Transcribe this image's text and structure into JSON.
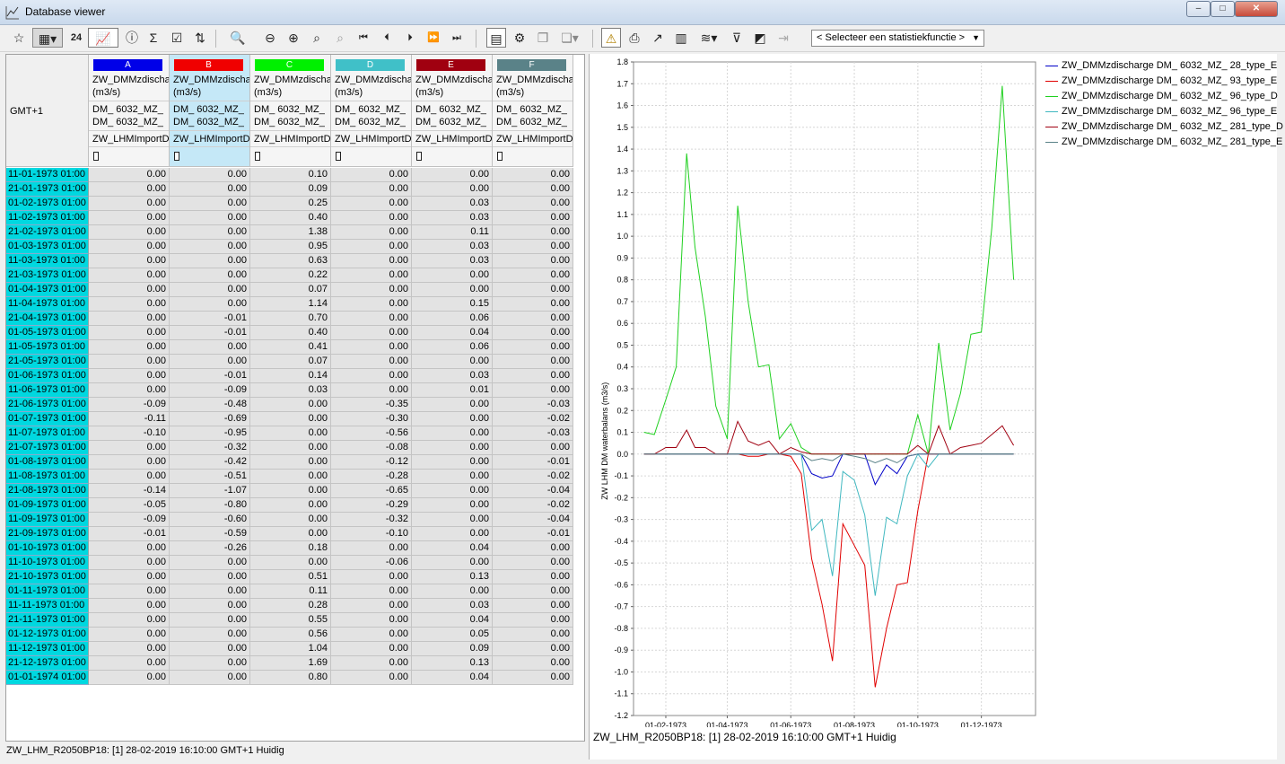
{
  "window": {
    "title": "Database viewer",
    "minimize": "–",
    "maximize": "□",
    "close": "✕"
  },
  "toolbar": {
    "rows_label": "24",
    "stat_select": "< Selecteer een statistiekfunctie >"
  },
  "table": {
    "timezone": "GMT+1",
    "columns": [
      {
        "letter": "A",
        "color": "#0000e8",
        "l1": "ZW_DMMzdischa",
        "l2": "(m3/s)",
        "l3": "DM_ 6032_MZ_",
        "l4": "DM_ 6032_MZ_",
        "l5": "ZW_LHMImportD"
      },
      {
        "letter": "B",
        "color": "#f00000",
        "l1": "ZW_DMMzdischa",
        "l2": "(m3/s)",
        "l3": "DM_ 6032_MZ_",
        "l4": "DM_ 6032_MZ_",
        "l5": "ZW_LHMImportD"
      },
      {
        "letter": "C",
        "color": "#00f000",
        "l1": "ZW_DMMzdischa",
        "l2": "(m3/s)",
        "l3": "DM_ 6032_MZ_",
        "l4": "DM_ 6032_MZ_",
        "l5": "ZW_LHMImportD"
      },
      {
        "letter": "D",
        "color": "#40c0c8",
        "l1": "ZW_DMMzdischa",
        "l2": "(m3/s)",
        "l3": "DM_ 6032_MZ_",
        "l4": "DM_ 6032_MZ_",
        "l5": "ZW_LHMImportD"
      },
      {
        "letter": "E",
        "color": "#a00010",
        "l1": "ZW_DMMzdischa",
        "l2": "(m3/s)",
        "l3": "DM_ 6032_MZ_",
        "l4": "DM_ 6032_MZ_",
        "l5": "ZW_LHMImportD"
      },
      {
        "letter": "F",
        "color": "#5a8288",
        "l1": "ZW_DMMzdischa",
        "l2": "(m3/s)",
        "l3": "DM_ 6032_MZ_",
        "l4": "DM_ 6032_MZ_",
        "l5": "ZW_LHMImportD"
      }
    ],
    "rows": [
      [
        "11-01-1973 01:00",
        "0.00",
        "0.00",
        "0.10",
        "0.00",
        "0.00",
        "0.00"
      ],
      [
        "21-01-1973 01:00",
        "0.00",
        "0.00",
        "0.09",
        "0.00",
        "0.00",
        "0.00"
      ],
      [
        "01-02-1973 01:00",
        "0.00",
        "0.00",
        "0.25",
        "0.00",
        "0.03",
        "0.00"
      ],
      [
        "11-02-1973 01:00",
        "0.00",
        "0.00",
        "0.40",
        "0.00",
        "0.03",
        "0.00"
      ],
      [
        "21-02-1973 01:00",
        "0.00",
        "0.00",
        "1.38",
        "0.00",
        "0.11",
        "0.00"
      ],
      [
        "01-03-1973 01:00",
        "0.00",
        "0.00",
        "0.95",
        "0.00",
        "0.03",
        "0.00"
      ],
      [
        "11-03-1973 01:00",
        "0.00",
        "0.00",
        "0.63",
        "0.00",
        "0.03",
        "0.00"
      ],
      [
        "21-03-1973 01:00",
        "0.00",
        "0.00",
        "0.22",
        "0.00",
        "0.00",
        "0.00"
      ],
      [
        "01-04-1973 01:00",
        "0.00",
        "0.00",
        "0.07",
        "0.00",
        "0.00",
        "0.00"
      ],
      [
        "11-04-1973 01:00",
        "0.00",
        "0.00",
        "1.14",
        "0.00",
        "0.15",
        "0.00"
      ],
      [
        "21-04-1973 01:00",
        "0.00",
        "-0.01",
        "0.70",
        "0.00",
        "0.06",
        "0.00"
      ],
      [
        "01-05-1973 01:00",
        "0.00",
        "-0.01",
        "0.40",
        "0.00",
        "0.04",
        "0.00"
      ],
      [
        "11-05-1973 01:00",
        "0.00",
        "0.00",
        "0.41",
        "0.00",
        "0.06",
        "0.00"
      ],
      [
        "21-05-1973 01:00",
        "0.00",
        "0.00",
        "0.07",
        "0.00",
        "0.00",
        "0.00"
      ],
      [
        "01-06-1973 01:00",
        "0.00",
        "-0.01",
        "0.14",
        "0.00",
        "0.03",
        "0.00"
      ],
      [
        "11-06-1973 01:00",
        "0.00",
        "-0.09",
        "0.03",
        "0.00",
        "0.01",
        "0.00"
      ],
      [
        "21-06-1973 01:00",
        "-0.09",
        "-0.48",
        "0.00",
        "-0.35",
        "0.00",
        "-0.03"
      ],
      [
        "01-07-1973 01:00",
        "-0.11",
        "-0.69",
        "0.00",
        "-0.30",
        "0.00",
        "-0.02"
      ],
      [
        "11-07-1973 01:00",
        "-0.10",
        "-0.95",
        "0.00",
        "-0.56",
        "0.00",
        "-0.03"
      ],
      [
        "21-07-1973 01:00",
        "0.00",
        "-0.32",
        "0.00",
        "-0.08",
        "0.00",
        "0.00"
      ],
      [
        "01-08-1973 01:00",
        "0.00",
        "-0.42",
        "0.00",
        "-0.12",
        "0.00",
        "-0.01"
      ],
      [
        "11-08-1973 01:00",
        "0.00",
        "-0.51",
        "0.00",
        "-0.28",
        "0.00",
        "-0.02"
      ],
      [
        "21-08-1973 01:00",
        "-0.14",
        "-1.07",
        "0.00",
        "-0.65",
        "0.00",
        "-0.04"
      ],
      [
        "01-09-1973 01:00",
        "-0.05",
        "-0.80",
        "0.00",
        "-0.29",
        "0.00",
        "-0.02"
      ],
      [
        "11-09-1973 01:00",
        "-0.09",
        "-0.60",
        "0.00",
        "-0.32",
        "0.00",
        "-0.04"
      ],
      [
        "21-09-1973 01:00",
        "-0.01",
        "-0.59",
        "0.00",
        "-0.10",
        "0.00",
        "-0.01"
      ],
      [
        "01-10-1973 01:00",
        "0.00",
        "-0.26",
        "0.18",
        "0.00",
        "0.04",
        "0.00"
      ],
      [
        "11-10-1973 01:00",
        "0.00",
        "0.00",
        "0.00",
        "-0.06",
        "0.00",
        "0.00"
      ],
      [
        "21-10-1973 01:00",
        "0.00",
        "0.00",
        "0.51",
        "0.00",
        "0.13",
        "0.00"
      ],
      [
        "01-11-1973 01:00",
        "0.00",
        "0.00",
        "0.11",
        "0.00",
        "0.00",
        "0.00"
      ],
      [
        "11-11-1973 01:00",
        "0.00",
        "0.00",
        "0.28",
        "0.00",
        "0.03",
        "0.00"
      ],
      [
        "21-11-1973 01:00",
        "0.00",
        "0.00",
        "0.55",
        "0.00",
        "0.04",
        "0.00"
      ],
      [
        "01-12-1973 01:00",
        "0.00",
        "0.00",
        "0.56",
        "0.00",
        "0.05",
        "0.00"
      ],
      [
        "11-12-1973 01:00",
        "0.00",
        "0.00",
        "1.04",
        "0.00",
        "0.09",
        "0.00"
      ],
      [
        "21-12-1973 01:00",
        "0.00",
        "0.00",
        "1.69",
        "0.00",
        "0.13",
        "0.00"
      ],
      [
        "01-01-1974 01:00",
        "0.00",
        "0.00",
        "0.80",
        "0.00",
        "0.04",
        "0.00"
      ]
    ]
  },
  "status": {
    "left": "ZW_LHM_R2050BP18: [1] 28-02-2019 16:10:00 GMT+1 Huidig"
  },
  "chart_data": {
    "type": "line",
    "title": "",
    "ylabel": "ZW LHM DM waterbalans (m3/s)",
    "ylim": [
      -1.2,
      1.8
    ],
    "ytick_step": 0.1,
    "grid": true,
    "legend_position": "right",
    "x": [
      "11-01-1973",
      "21-01-1973",
      "01-02-1973",
      "11-02-1973",
      "21-02-1973",
      "01-03-1973",
      "11-03-1973",
      "21-03-1973",
      "01-04-1973",
      "11-04-1973",
      "21-04-1973",
      "01-05-1973",
      "11-05-1973",
      "21-05-1973",
      "01-06-1973",
      "11-06-1973",
      "21-06-1973",
      "01-07-1973",
      "11-07-1973",
      "21-07-1973",
      "01-08-1973",
      "11-08-1973",
      "21-08-1973",
      "01-09-1973",
      "11-09-1973",
      "21-09-1973",
      "01-10-1973",
      "11-10-1973",
      "21-10-1973",
      "01-11-1973",
      "11-11-1973",
      "21-11-1973",
      "01-12-1973",
      "11-12-1973",
      "21-12-1973",
      "01-01-1974"
    ],
    "xticks": [
      "01-02-1973",
      "01-04-1973",
      "01-06-1973",
      "01-08-1973",
      "01-10-1973",
      "01-12-1973"
    ],
    "series": [
      {
        "name": "ZW_DMMzdischarge DM_ 6032_MZ_   28_type_E",
        "color": "#0000c8",
        "values": [
          0,
          0,
          0,
          0,
          0,
          0,
          0,
          0,
          0,
          0,
          0,
          0,
          0,
          0,
          0,
          0,
          -0.09,
          -0.11,
          -0.1,
          0,
          0,
          0,
          -0.14,
          -0.05,
          -0.09,
          -0.01,
          0,
          0,
          0,
          0,
          0,
          0,
          0,
          0,
          0,
          0
        ]
      },
      {
        "name": "ZW_DMMzdischarge DM_ 6032_MZ_   93_type_E",
        "color": "#e00000",
        "values": [
          0,
          0,
          0,
          0,
          0,
          0,
          0,
          0,
          0,
          0,
          -0.01,
          -0.01,
          0,
          0,
          -0.01,
          -0.09,
          -0.48,
          -0.69,
          -0.95,
          -0.32,
          -0.42,
          -0.51,
          -1.07,
          -0.8,
          -0.6,
          -0.59,
          -0.26,
          0,
          0,
          0,
          0,
          0,
          0,
          0,
          0,
          0
        ]
      },
      {
        "name": "ZW_DMMzdischarge DM_ 6032_MZ_   96_type_D",
        "color": "#20d020",
        "values": [
          0.1,
          0.09,
          0.25,
          0.4,
          1.38,
          0.95,
          0.63,
          0.22,
          0.07,
          1.14,
          0.7,
          0.4,
          0.41,
          0.07,
          0.14,
          0.03,
          0,
          0,
          0,
          0,
          0,
          0,
          0,
          0,
          0,
          0,
          0.18,
          0,
          0.51,
          0.11,
          0.28,
          0.55,
          0.56,
          1.04,
          1.69,
          0.8
        ]
      },
      {
        "name": "ZW_DMMzdischarge DM_ 6032_MZ_   96_type_E",
        "color": "#40b8c0",
        "values": [
          0,
          0,
          0,
          0,
          0,
          0,
          0,
          0,
          0,
          0,
          0,
          0,
          0,
          0,
          0,
          0,
          -0.35,
          -0.3,
          -0.56,
          -0.08,
          -0.12,
          -0.28,
          -0.65,
          -0.29,
          -0.32,
          -0.1,
          0,
          -0.06,
          0,
          0,
          0,
          0,
          0,
          0,
          0,
          0
        ]
      },
      {
        "name": "ZW_DMMzdischarge DM_ 6032_MZ_   281_type_D",
        "color": "#a00010",
        "values": [
          0,
          0,
          0.03,
          0.03,
          0.11,
          0.03,
          0.03,
          0,
          0,
          0.15,
          0.06,
          0.04,
          0.06,
          0,
          0.03,
          0.01,
          0,
          0,
          0,
          0,
          0,
          0,
          0,
          0,
          0,
          0,
          0.04,
          0,
          0.13,
          0,
          0.03,
          0.04,
          0.05,
          0.09,
          0.13,
          0.04
        ]
      },
      {
        "name": "ZW_DMMzdischarge DM_ 6032_MZ_   281_type_E",
        "color": "#5a8288",
        "values": [
          0,
          0,
          0,
          0,
          0,
          0,
          0,
          0,
          0,
          0,
          0,
          0,
          0,
          0,
          0,
          0,
          -0.03,
          -0.02,
          -0.03,
          0,
          -0.01,
          -0.02,
          -0.04,
          -0.02,
          -0.04,
          -0.01,
          0,
          0,
          0,
          0,
          0,
          0,
          0,
          0,
          0,
          0
        ]
      }
    ],
    "status": "ZW_LHM_R2050BP18: [1] 28-02-2019 16:10:00 GMT+1 Huidig"
  }
}
